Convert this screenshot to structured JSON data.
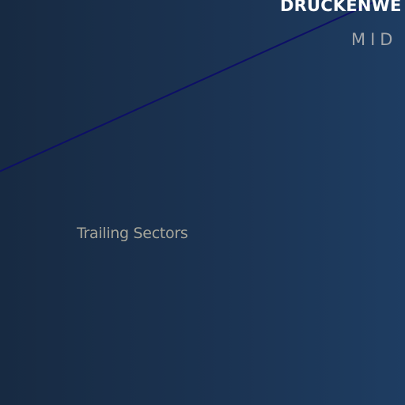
{
  "chart_data": {
    "type": "line",
    "title": "",
    "xlabel": "",
    "ylabel": "",
    "grid": false,
    "legend": "none",
    "series": [
      {
        "name": "DRUCKENWE",
        "color": "#0d0f66",
        "points": [
          [
            0,
            0.58
          ],
          [
            1,
            1.0
          ]
        ]
      }
    ],
    "annotations": {
      "leading": "DRUCKENWE",
      "mid": "MID",
      "trailing": "Trailing Sectors"
    },
    "xlim": [
      0,
      1
    ],
    "ylim": [
      0,
      1
    ],
    "colors": {
      "background_left": "#172a42",
      "background_right": "#1e3d62",
      "leading_label": "#ffffff",
      "mid_label": "#a3a7ab",
      "trailing_label": "#a7a69a"
    }
  }
}
